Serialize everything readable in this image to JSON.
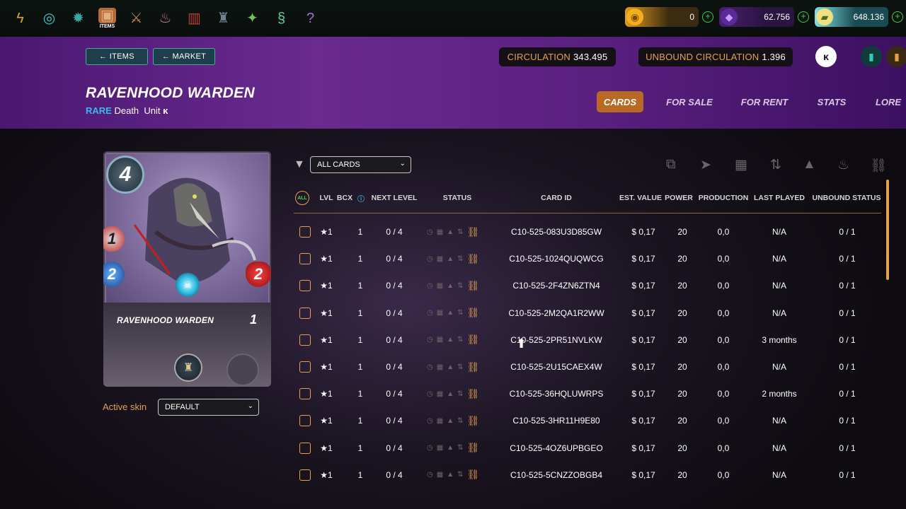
{
  "nav": {
    "items": [
      {
        "name": "splinterlands-logo-icon",
        "glyph": "ϟ",
        "color": "#d9a441",
        "caption": ""
      },
      {
        "name": "swirl-icon",
        "glyph": "◎",
        "color": "#3cc8c8",
        "caption": ""
      },
      {
        "name": "cog-icon",
        "glyph": "✹",
        "color": "#3aa8a0",
        "caption": ""
      },
      {
        "name": "items-chest-icon",
        "glyph": "▣",
        "color": "#e0b080",
        "caption": "ITEMS"
      },
      {
        "name": "sword-icon",
        "glyph": "⚔",
        "color": "#c08a50",
        "caption": ""
      },
      {
        "name": "cake-icon",
        "glyph": "♨",
        "color": "#c08090",
        "caption": ""
      },
      {
        "name": "banner-icon",
        "glyph": "▥",
        "color": "#c04030",
        "caption": ""
      },
      {
        "name": "castle-icon",
        "glyph": "♜",
        "color": "#708090",
        "caption": ""
      },
      {
        "name": "leaf-icon",
        "glyph": "✦",
        "color": "#70c060",
        "caption": ""
      },
      {
        "name": "serpent-icon",
        "glyph": "§",
        "color": "#60d0a0",
        "caption": ""
      },
      {
        "name": "question-icon",
        "glyph": "?",
        "color": "#a070e0",
        "caption": ""
      }
    ]
  },
  "wallets": {
    "dec": "0",
    "sps": "62.756",
    "credits": "648.136"
  },
  "header": {
    "back_items": "← ITEMS",
    "back_market": "← MARKET",
    "circulation_label": "CIRCULATION",
    "circulation_value": "343.495",
    "unbound_label": "UNBOUND CIRCULATION",
    "unbound_value": "1.396",
    "title": "RAVENHOOD WARDEN",
    "rarity": "RARE",
    "element": "Death",
    "type": "Unit",
    "tabs": [
      "CARDS",
      "FOR SALE",
      "FOR RENT",
      "STATS",
      "LORE"
    ]
  },
  "card": {
    "mana": "4",
    "ranged": "1",
    "speed": "2",
    "health": "2",
    "name": "RAVENHOOD WARDEN",
    "level": "1"
  },
  "skin": {
    "label": "Active skin",
    "value": "DEFAULT"
  },
  "filter": {
    "value": "ALL CARDS"
  },
  "table": {
    "all_label": "ALL",
    "headers": [
      "LVL",
      "BCX",
      "NEXT LEVEL",
      "STATUS",
      "CARD ID",
      "EST. VALUE",
      "POWER",
      "PRODUCTION",
      "LAST PLAYED",
      "UNBOUND STATUS"
    ],
    "rows": [
      {
        "lvl": "★1",
        "bcx": "1",
        "next": "0 / 4",
        "id": "C10-525-083U3D85GW",
        "value": "$ 0,17",
        "power": "20",
        "production": "0,0",
        "played": "N/A",
        "unbound": "0 / 1"
      },
      {
        "lvl": "★1",
        "bcx": "1",
        "next": "0 / 4",
        "id": "C10-525-1024QUQWCG",
        "value": "$ 0,17",
        "power": "20",
        "production": "0,0",
        "played": "N/A",
        "unbound": "0 / 1"
      },
      {
        "lvl": "★1",
        "bcx": "1",
        "next": "0 / 4",
        "id": "C10-525-2F4ZN6ZTN4",
        "value": "$ 0,17",
        "power": "20",
        "production": "0,0",
        "played": "N/A",
        "unbound": "0 / 1"
      },
      {
        "lvl": "★1",
        "bcx": "1",
        "next": "0 / 4",
        "id": "C10-525-2M2QA1R2WW",
        "value": "$ 0,17",
        "power": "20",
        "production": "0,0",
        "played": "N/A",
        "unbound": "0 / 1"
      },
      {
        "lvl": "★1",
        "bcx": "1",
        "next": "0 / 4",
        "id": "C10-525-2PR51NVLKW",
        "value": "$ 0,17",
        "power": "20",
        "production": "0,0",
        "played": "3 months",
        "unbound": "0 / 1"
      },
      {
        "lvl": "★1",
        "bcx": "1",
        "next": "0 / 4",
        "id": "C10-525-2U15CAEX4W",
        "value": "$ 0,17",
        "power": "20",
        "production": "0,0",
        "played": "N/A",
        "unbound": "0 / 1"
      },
      {
        "lvl": "★1",
        "bcx": "1",
        "next": "0 / 4",
        "id": "C10-525-36HQLUWRPS",
        "value": "$ 0,17",
        "power": "20",
        "production": "0,0",
        "played": "2 months",
        "unbound": "0 / 1"
      },
      {
        "lvl": "★1",
        "bcx": "1",
        "next": "0 / 4",
        "id": "C10-525-3HR11H9E80",
        "value": "$ 0,17",
        "power": "20",
        "production": "0,0",
        "played": "N/A",
        "unbound": "0 / 1"
      },
      {
        "lvl": "★1",
        "bcx": "1",
        "next": "0 / 4",
        "id": "C10-525-4OZ6UPBGEO",
        "value": "$ 0,17",
        "power": "20",
        "production": "0,0",
        "played": "N/A",
        "unbound": "0 / 1"
      },
      {
        "lvl": "★1",
        "bcx": "1",
        "next": "0 / 4",
        "id": "C10-525-5CNZZOBGB4",
        "value": "$ 0,17",
        "power": "20",
        "production": "0,0",
        "played": "N/A",
        "unbound": "0 / 1"
      }
    ]
  },
  "colors": {
    "accent": "#e5a050",
    "rarity_rare": "#3bb8f0",
    "tab_active": "#b86a24",
    "header_purple": "#6a2a90"
  }
}
